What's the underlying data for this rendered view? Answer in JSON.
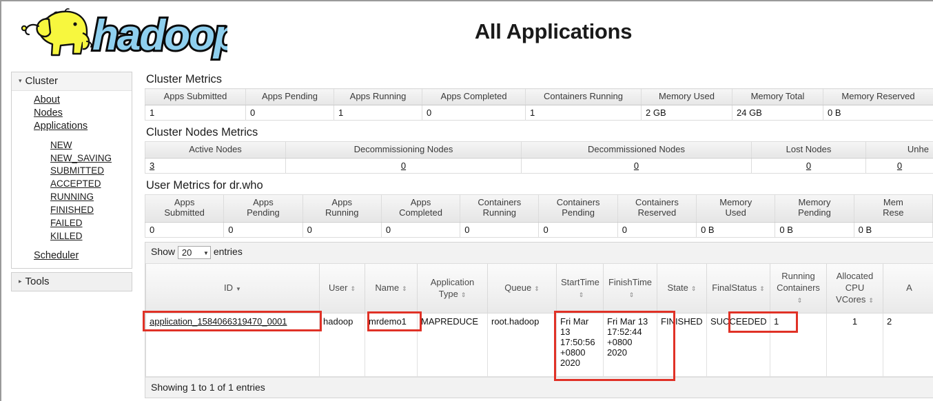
{
  "header": {
    "logo_alt": "hadoop",
    "title": "All Applications"
  },
  "sidebar": {
    "cluster": {
      "label": "Cluster",
      "expanded": true,
      "items": [
        {
          "label": "About",
          "level": 1
        },
        {
          "label": "Nodes",
          "level": 1
        },
        {
          "label": "Applications",
          "level": 1
        },
        {
          "label": "NEW",
          "level": 2
        },
        {
          "label": "NEW_SAVING",
          "level": 2
        },
        {
          "label": "SUBMITTED",
          "level": 2
        },
        {
          "label": "ACCEPTED",
          "level": 2
        },
        {
          "label": "RUNNING",
          "level": 2
        },
        {
          "label": "FINISHED",
          "level": 2
        },
        {
          "label": "FAILED",
          "level": 2
        },
        {
          "label": "KILLED",
          "level": 2
        },
        {
          "label": "Scheduler",
          "level": 1
        }
      ]
    },
    "tools": {
      "label": "Tools",
      "expanded": false
    }
  },
  "cluster_metrics": {
    "title": "Cluster Metrics",
    "headers": [
      "Apps Submitted",
      "Apps Pending",
      "Apps Running",
      "Apps Completed",
      "Containers Running",
      "Memory Used",
      "Memory Total",
      "Memory Reserved"
    ],
    "values": [
      "1",
      "0",
      "1",
      "0",
      "1",
      "2 GB",
      "24 GB",
      "0 B"
    ]
  },
  "cluster_nodes_metrics": {
    "title": "Cluster Nodes Metrics",
    "headers": [
      "Active Nodes",
      "Decommissioning Nodes",
      "Decommissioned Nodes",
      "Lost Nodes",
      "Unhe"
    ],
    "values": [
      "3",
      "0",
      "0",
      "0",
      "0"
    ]
  },
  "user_metrics": {
    "title": "User Metrics for dr.who",
    "headers": [
      "Apps\nSubmitted",
      "Apps\nPending",
      "Apps\nRunning",
      "Apps\nCompleted",
      "Containers\nRunning",
      "Containers\nPending",
      "Containers\nReserved",
      "Memory\nUsed",
      "Memory\nPending",
      "Mem\nRese"
    ],
    "values": [
      "0",
      "0",
      "0",
      "0",
      "0",
      "0",
      "0",
      "0 B",
      "0 B",
      "0 B"
    ]
  },
  "apps_table": {
    "show_label": "Show",
    "page_size": "20",
    "entries_label": "entries",
    "footer": "Showing 1 to 1 of 1 entries",
    "columns": [
      {
        "label": "ID",
        "sort": "desc"
      },
      {
        "label": "User",
        "sort": "both"
      },
      {
        "label": "Name",
        "sort": "both"
      },
      {
        "label": "Application\nType",
        "sort": "both"
      },
      {
        "label": "Queue",
        "sort": "both"
      },
      {
        "label": "StartTime",
        "sort": "both"
      },
      {
        "label": "FinishTime",
        "sort": "both"
      },
      {
        "label": "State",
        "sort": "both"
      },
      {
        "label": "FinalStatus",
        "sort": "both"
      },
      {
        "label": "Running\nContainers",
        "sort": "both"
      },
      {
        "label": "Allocated\nCPU\nVCores",
        "sort": "both"
      },
      {
        "label": "A",
        "sort": "none"
      }
    ],
    "rows": [
      {
        "id": "application_1584066319470_0001",
        "user": "hadoop",
        "name": "mrdemo1",
        "app_type": "MAPREDUCE",
        "queue": "root.hadoop",
        "start_time": "Fri Mar 13 17:50:56 +0800 2020",
        "finish_time": "Fri Mar 13 17:52:44 +0800 2020",
        "state": "FINISHED",
        "final_status": "SUCCEEDED",
        "running_containers": "1",
        "allocated_cpu_vcores": "1",
        "extra": "2"
      }
    ]
  },
  "annotations": {
    "highlight_color": "#e03126",
    "boxes": [
      "application-id",
      "application-name",
      "start-finish-time",
      "final-status"
    ]
  }
}
